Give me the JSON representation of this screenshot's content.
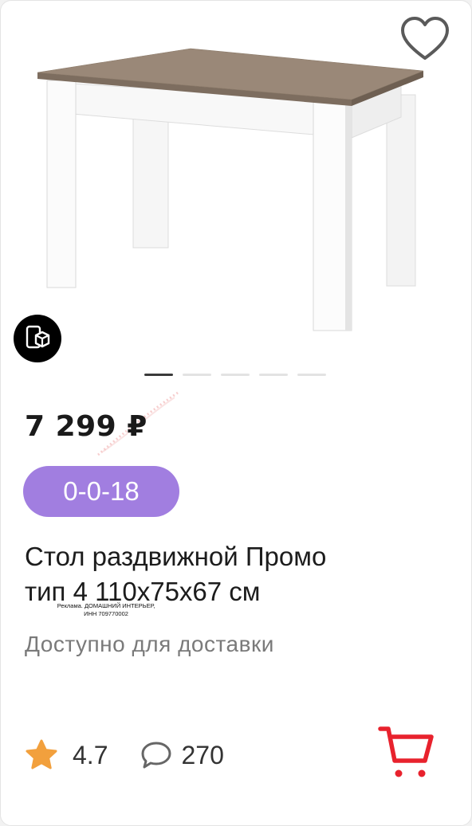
{
  "price": {
    "current": "7 299 ₽"
  },
  "promo": {
    "label": "0-0-18",
    "color": "#a17ee0"
  },
  "product": {
    "title_line1": "Стол раздвижной Промо",
    "title_line2": "тип 4 110x75x67 см"
  },
  "ad": {
    "line1": "Реклама. ДОМАШНИЙ ИНТЕРЬЕР,",
    "line2": "ИНН 709770002"
  },
  "availability": "Доступно для доставки",
  "rating": {
    "value": "4.7",
    "reviews_count": "270"
  },
  "gallery": {
    "total_images": 5,
    "active_index": 0
  },
  "icons": {
    "favorite": "heart-outline-icon",
    "ar": "ar-box-icon",
    "rating": "star-icon",
    "reviews": "speech-bubble-icon",
    "cart": "cart-icon"
  },
  "colors": {
    "star": "#f2a03d",
    "cart": "#e8222d",
    "promo": "#a17ee0",
    "price": "#1a1a1a"
  }
}
